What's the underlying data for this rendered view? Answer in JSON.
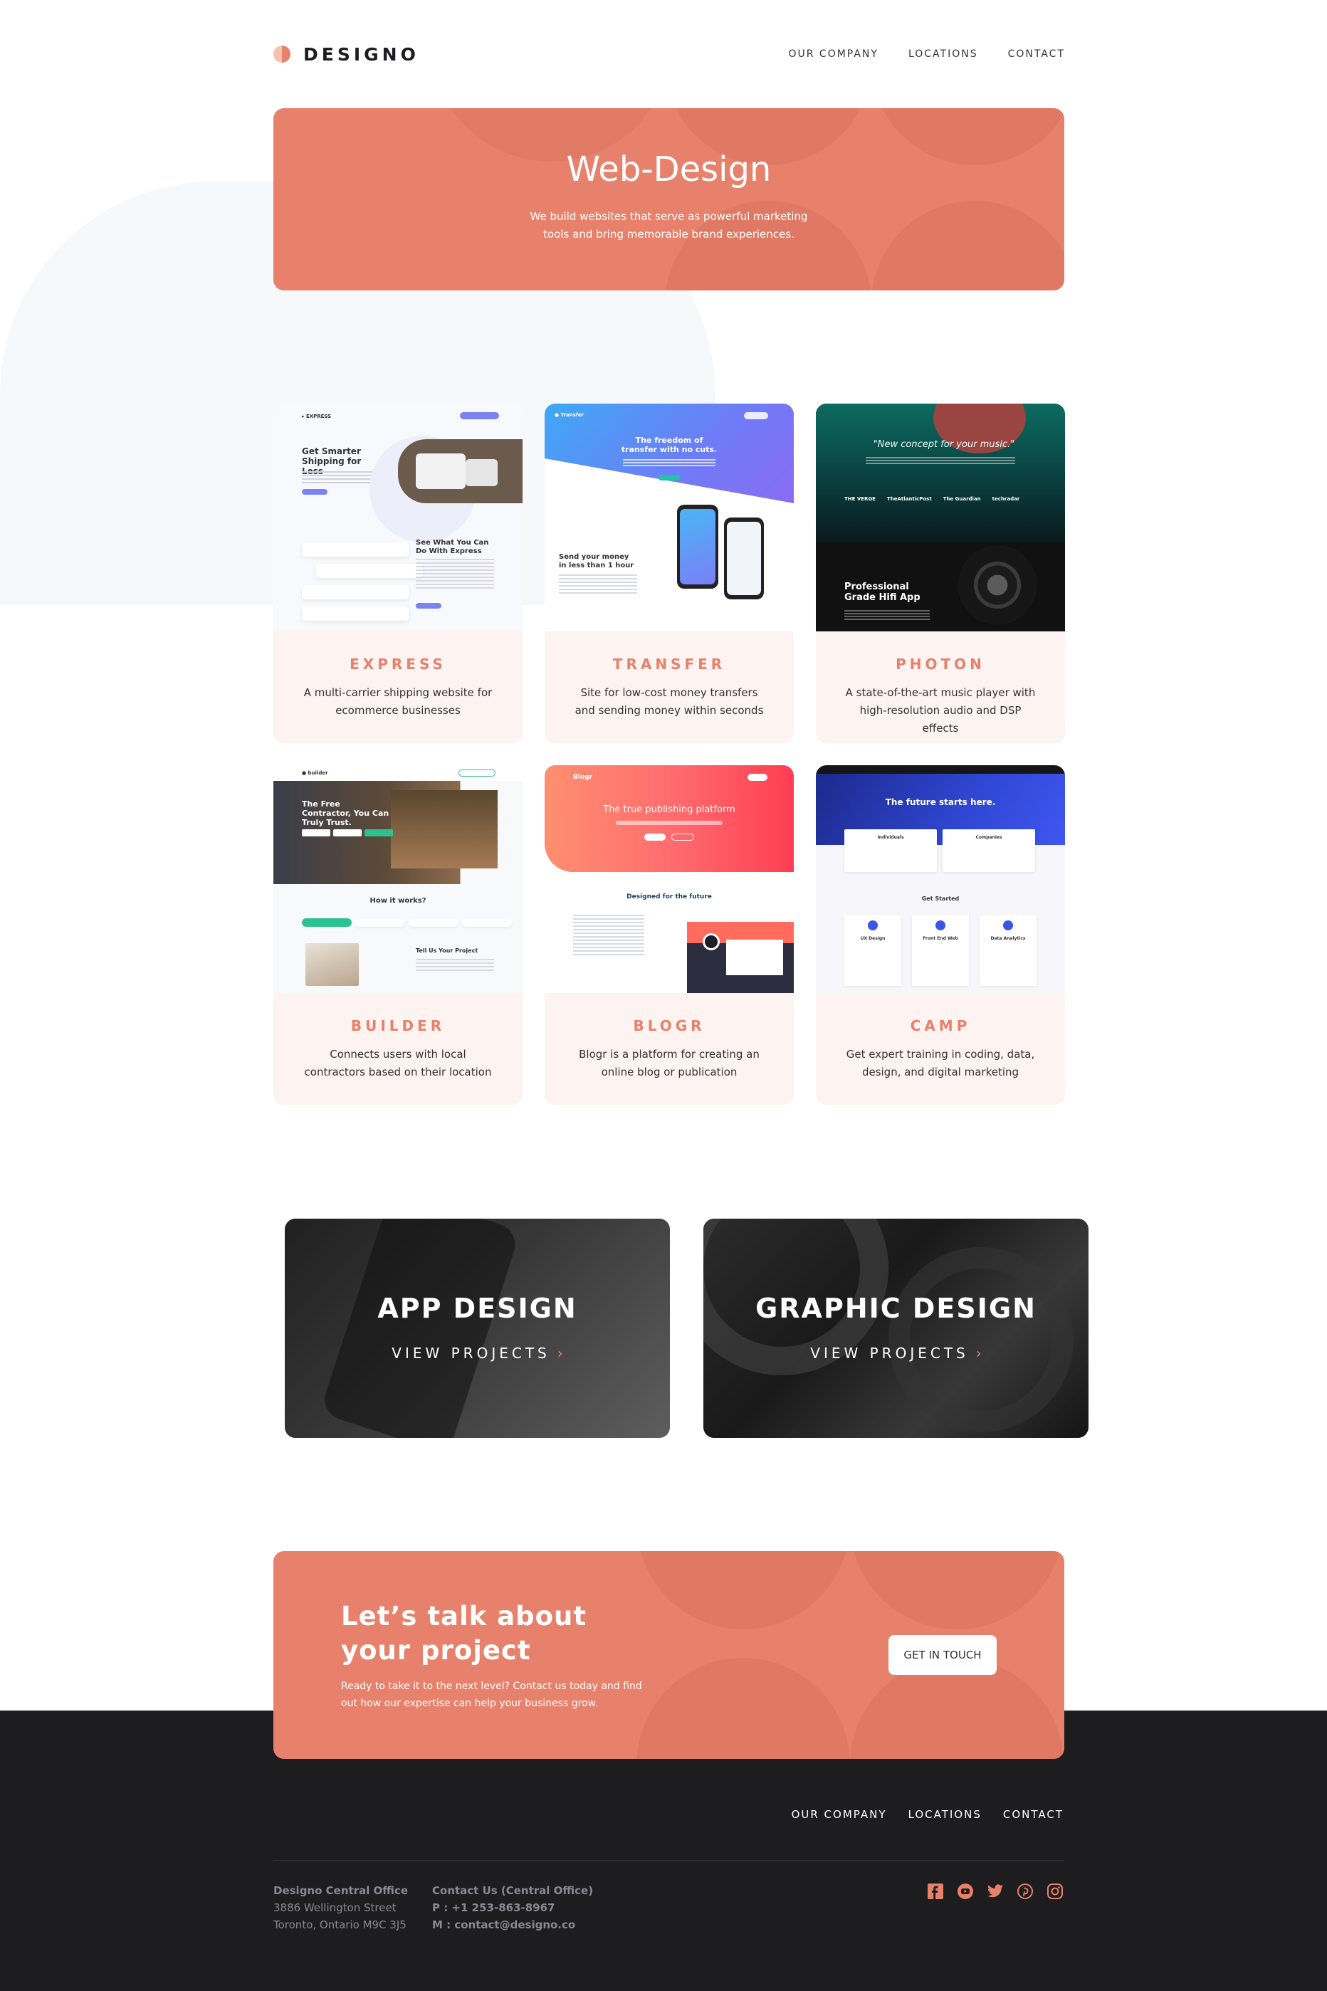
{
  "brand": {
    "name": "DESIGNO"
  },
  "nav": [
    "OUR COMPANY",
    "LOCATIONS",
    "CONTACT"
  ],
  "hero": {
    "title": "Web-Design",
    "subtitle": "We build websites that serve as powerful marketing tools and bring memorable brand experiences."
  },
  "projects": [
    {
      "name": "EXPRESS",
      "desc": "A multi-carrier shipping website for ecommerce businesses"
    },
    {
      "name": "TRANSFER",
      "desc": "Site for low-cost money transfers and sending money within seconds"
    },
    {
      "name": "PHOTON",
      "desc": "A state-of-the-art music player with high-resolution audio and DSP effects"
    },
    {
      "name": "BUILDER",
      "desc": "Connects users with local contractors based on their location"
    },
    {
      "name": "BLOGR",
      "desc": "Blogr is a platform for creating an online blog or publication"
    },
    {
      "name": "CAMP",
      "desc": "Get expert training in coding, data, design, and digital marketing"
    }
  ],
  "mockups": {
    "express": {
      "headline": "Get Smarter Shipping for Less",
      "section": "See What You Can Do With Express"
    },
    "transfer": {
      "headline": "The freedom of transfer with no cuts.",
      "section": "Send your money in less than 1 hour"
    },
    "photon": {
      "quote": "\"New concept for your music.\"",
      "headline": "Professional Grade Hifi App",
      "press": [
        "THE VERGE",
        "TheAtlanticPost",
        "The Guardian",
        "techradar"
      ]
    },
    "builder": {
      "headline": "The Free Contractor, You Can Truly Trust.",
      "section": "How it works?",
      "sub": "Tell Us Your Project"
    },
    "blogr": {
      "headline": "The true publishing platform",
      "section": "Designed for the future"
    },
    "camp": {
      "headline": "The future starts here.",
      "section": "Get Started",
      "courses": [
        "UX Design",
        "Front End Web",
        "Data Analytics"
      ],
      "boxes": [
        "Individuals",
        "Companies"
      ]
    }
  },
  "categories": [
    {
      "title": "APP DESIGN",
      "link": "VIEW PROJECTS"
    },
    {
      "title": "GRAPHIC DESIGN",
      "link": "VIEW PROJECTS"
    }
  ],
  "cta": {
    "title": "Let’s talk about your project",
    "text": "Ready to take it to the next level? Contact us today and find out how our expertise can help your business grow.",
    "button": "GET IN TOUCH"
  },
  "footer": {
    "nav": [
      "OUR COMPANY",
      "LOCATIONS",
      "CONTACT"
    ],
    "office": {
      "title": "Designo Central Office",
      "line1": "3886 Wellington Street",
      "line2": "Toronto, Ontario M9C 3J5"
    },
    "contact": {
      "title": "Contact Us (Central Office)",
      "phone": "P : +1 253-863-8967",
      "email": "M : contact@designo.co"
    },
    "social": [
      "facebook-icon",
      "youtube-icon",
      "twitter-icon",
      "pinterest-icon",
      "instagram-icon"
    ]
  },
  "colors": {
    "accent": "#e7816b",
    "accent_light": "#fdf3f0",
    "dark": "#1d1c1e",
    "text": "#333136"
  }
}
